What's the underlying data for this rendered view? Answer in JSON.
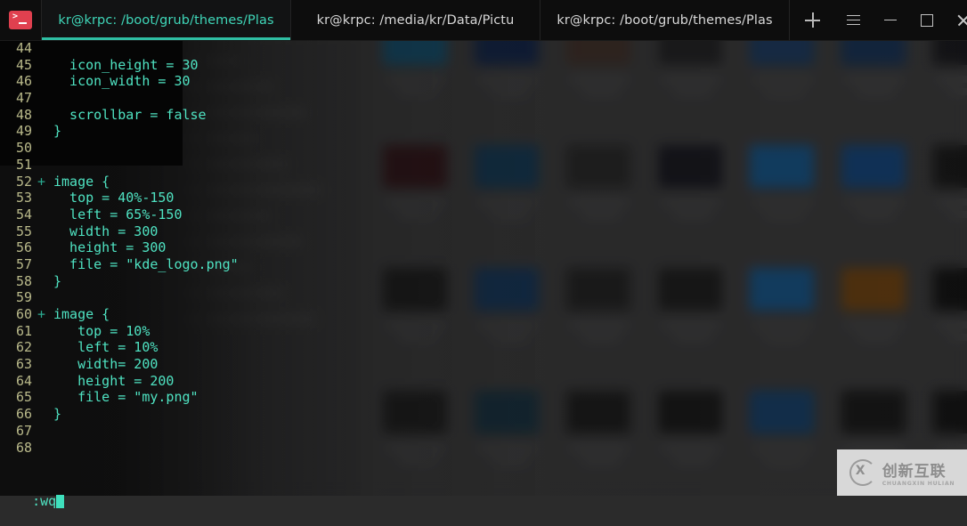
{
  "window": {
    "app_icon": "terminal-icon",
    "tabs": [
      {
        "label": "kr@krpc: /boot/grub/themes/Plas",
        "active": true
      },
      {
        "label": "kr@krpc: /media/kr/Data/Pictu",
        "active": false
      },
      {
        "label": "kr@krpc: /boot/grub/themes/Plas",
        "active": false
      }
    ],
    "new_tab_icon": "plus-icon",
    "controls": [
      {
        "name": "menu-icon",
        "label": "☰"
      },
      {
        "name": "minimize-icon",
        "label": "–"
      },
      {
        "name": "maximize-icon",
        "label": "□"
      },
      {
        "name": "close-icon",
        "label": "×"
      }
    ],
    "accent": "#2fbfa4",
    "active_tab_text_color": "#3fd6b8"
  },
  "editor": {
    "type": "vim",
    "foreground": "#4fe3c2",
    "linenumber_color": "#b9b98a",
    "diff_sign_color": "#2aa98f",
    "lines": [
      {
        "n": "44",
        "sign": "",
        "text": ""
      },
      {
        "n": "45",
        "sign": "",
        "text": "  icon_height = 30"
      },
      {
        "n": "46",
        "sign": "",
        "text": "  icon_width = 30"
      },
      {
        "n": "47",
        "sign": "",
        "text": ""
      },
      {
        "n": "48",
        "sign": "",
        "text": "  scrollbar = false"
      },
      {
        "n": "49",
        "sign": "",
        "text": "}"
      },
      {
        "n": "50",
        "sign": "",
        "text": ""
      },
      {
        "n": "51",
        "sign": "",
        "text": ""
      },
      {
        "n": "52",
        "sign": "+",
        "text": "image {"
      },
      {
        "n": "53",
        "sign": "",
        "text": "  top = 40%-150"
      },
      {
        "n": "54",
        "sign": "",
        "text": "  left = 65%-150"
      },
      {
        "n": "55",
        "sign": "",
        "text": "  width = 300"
      },
      {
        "n": "56",
        "sign": "",
        "text": "  height = 300"
      },
      {
        "n": "57",
        "sign": "",
        "text": "  file = \"kde_logo.png\""
      },
      {
        "n": "58",
        "sign": "",
        "text": "}"
      },
      {
        "n": "59",
        "sign": "",
        "text": ""
      },
      {
        "n": "60",
        "sign": "+",
        "text": "image {"
      },
      {
        "n": "61",
        "sign": "",
        "text": "   top = 10%"
      },
      {
        "n": "62",
        "sign": "",
        "text": "   left = 10%"
      },
      {
        "n": "63",
        "sign": "",
        "text": "   width= 200"
      },
      {
        "n": "64",
        "sign": "",
        "text": "   height = 200"
      },
      {
        "n": "65",
        "sign": "",
        "text": "   file = \"my.png\""
      },
      {
        "n": "66",
        "sign": "",
        "text": "}"
      },
      {
        "n": "67",
        "sign": "",
        "text": ""
      },
      {
        "n": "68",
        "sign": "",
        "text": ""
      }
    ],
    "command_line": ":wq",
    "cursor_visible": true
  },
  "watermark": {
    "chinese": "创新互联",
    "pinyin": "CHUANGXIN HULIAN",
    "logo_icon": "cx-logo-icon"
  },
  "background": {
    "description": "blurred file manager with thumbnail grid behind terminal",
    "sidebar_rows": 11,
    "grid_columns": 7,
    "grid_rows": 4
  }
}
